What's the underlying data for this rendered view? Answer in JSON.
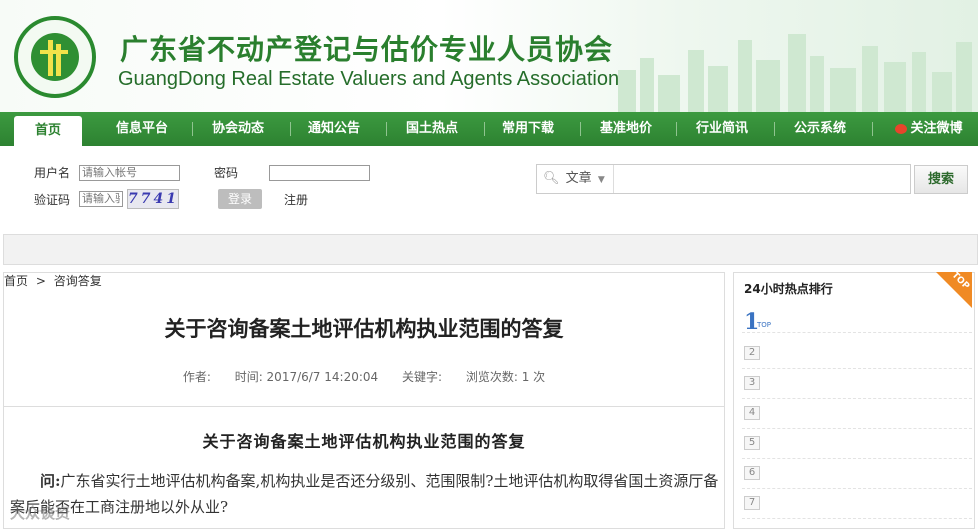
{
  "header": {
    "title_cn": "广东省不动产登记与估价专业人员协会",
    "title_en": "GuangDong Real Estate Valuers and Agents Association"
  },
  "nav": {
    "items": [
      "首页",
      "信息平台",
      "协会动态",
      "通知公告",
      "国土热点",
      "常用下载",
      "基准地价",
      "行业简讯",
      "公示系统",
      "关注微博"
    ]
  },
  "login": {
    "username_label": "用户名",
    "username_placeholder": "请输入帐号",
    "password_label": "密码",
    "captcha_label": "验证码",
    "captcha_placeholder": "请输入验证码",
    "captcha_code": "7741",
    "login_button": "登录",
    "register_link": "注册"
  },
  "search": {
    "category": "文章",
    "button": "搜索"
  },
  "breadcrumb": {
    "home": "首页",
    "sep": ">",
    "current": "咨询答复"
  },
  "article": {
    "title": "关于咨询备案土地评估机构执业范围的答复",
    "author_label": "作者:",
    "time_label": "时间: 2017/6/7 14:20:04",
    "keyword_label": "关键字:",
    "views_label": "浏览次数: 1 次",
    "subtitle": "关于咨询备案土地评估机构执业范围的答复",
    "q_label": "问:",
    "q_text": "广东省实行土地评估机构备案,机构执业是否还分级别、范围限制?土地评估机构取得省国土资源厅备案后能否在工商注册地以外从业?",
    "watermark": "大众谈资"
  },
  "sidebar": {
    "title": "24小时热点排行",
    "tag": "TOP",
    "first_rank": "1",
    "first_rank_tag": "TOP",
    "ranks": [
      "2",
      "3",
      "4",
      "5",
      "6",
      "7"
    ]
  }
}
